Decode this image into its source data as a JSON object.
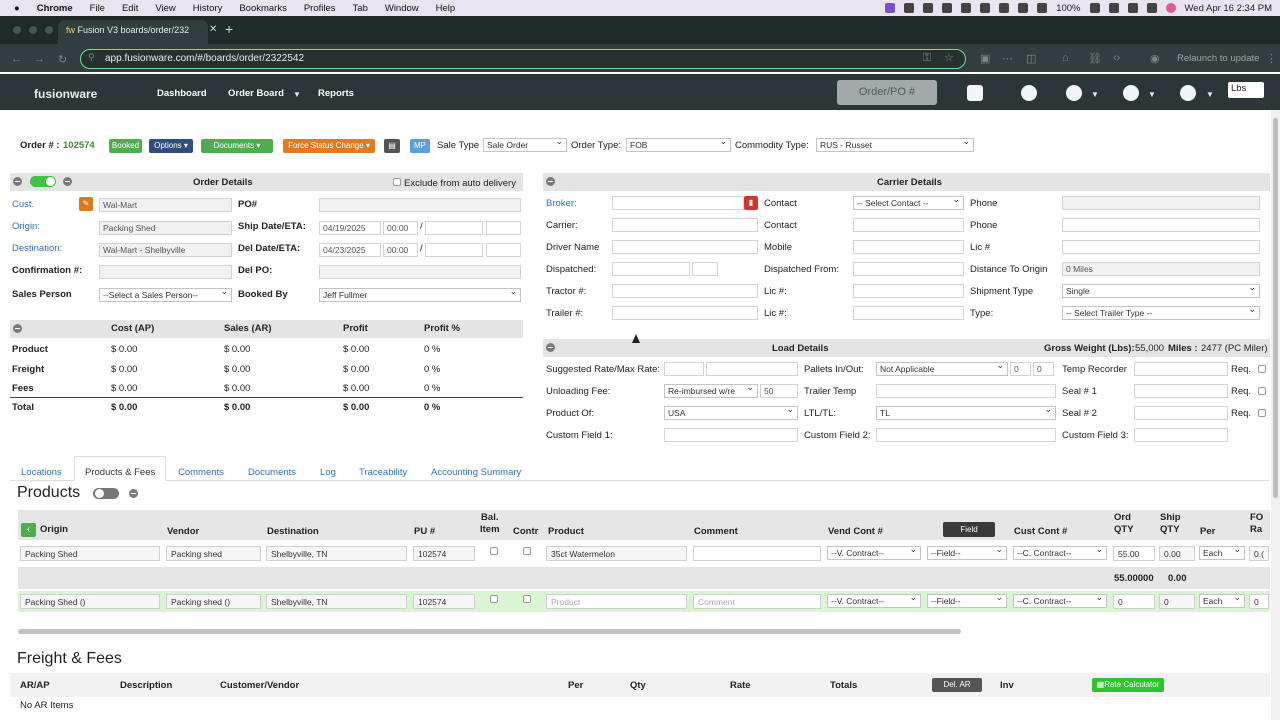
{
  "mac_menu": {
    "apple": "",
    "app": "Chrome",
    "items": [
      "File",
      "Edit",
      "View",
      "History",
      "Bookmarks",
      "Profiles",
      "Tab",
      "Window",
      "Help"
    ],
    "battery": "100%",
    "datetime": "Wed Apr 16  2:34 PM"
  },
  "browser": {
    "tab_title": "Fusion V3 boards/order/232",
    "url": "app.fusionware.com/#/boards/order/2322542",
    "relaunch": "Relaunch to update"
  },
  "app_nav": {
    "logo": "fusionware",
    "links": [
      "Dashboard",
      "Order Board",
      "Reports"
    ],
    "order_po": "Order/PO #",
    "units": "Lbs"
  },
  "order_bar": {
    "order_label": "Order # :",
    "order_number": "102574",
    "booked": "Booked",
    "options": "Options ▾",
    "documents": "Documents ▾",
    "force_status": "Force Status Change ▾",
    "mp": "MP",
    "sale_type_label": "Sale Type",
    "sale_type": "Sale Order",
    "order_type_label": "Order Type:",
    "order_type": "FOB",
    "commodity_label": "Commodity Type:",
    "commodity": "RUS - Russet"
  },
  "order_details": {
    "title": "Order Details",
    "exclude": "Exclude from auto delivery",
    "cust_label": "Cust.",
    "cust": "Wal-Mart",
    "po_label": "PO#",
    "origin_label": "Origin:",
    "origin": "Packing Shed",
    "ship_label": "Ship Date/ETA:",
    "ship_date": "04/19/2025",
    "ship_time": "00:00",
    "dest_label": "Destination:",
    "dest": "Wal-Mart - Shelbyville",
    "del_label": "Del Date/ETA:",
    "del_date": "04/23/2025",
    "del_time": "00:00",
    "confirm_label": "Confirmation #:",
    "delpo_label": "Del PO:",
    "sales_label": "Sales Person",
    "sales": "--Select a Sales Person--",
    "booked_label": "Booked By",
    "booked_by": "Jeff Fullmer",
    "slash": "/"
  },
  "financials": {
    "headers": [
      "Cost (AP)",
      "Sales (AR)",
      "Profit",
      "Profit %"
    ],
    "rows": [
      {
        "label": "Product",
        "cost": "$  0.00",
        "sales": "$  0.00",
        "profit": "$  0.00",
        "pct": "0 %"
      },
      {
        "label": "Freight",
        "cost": "$  0.00",
        "sales": "$  0.00",
        "profit": "$  0.00",
        "pct": "0 %"
      },
      {
        "label": "Fees",
        "cost": "$  0.00",
        "sales": "$  0.00",
        "profit": "$  0.00",
        "pct": "0 %"
      },
      {
        "label": "Total",
        "cost": "$  0.00",
        "sales": "$  0.00",
        "profit": "$  0.00",
        "pct": "0 %"
      }
    ]
  },
  "carrier": {
    "title": "Carrier Details",
    "broker": "Broker:",
    "contact": "Contact",
    "contact_sel": "-- Select Contact --",
    "phone": "Phone",
    "carrier": "Carrier:",
    "contact2": "Contact",
    "phone2": "Phone",
    "driver": "Driver Name",
    "mobile": "Mobile",
    "lic": "Lic #",
    "dispatched": "Dispatched:",
    "dispatched_from": "Dispatched From:",
    "distance": "Distance To Origin",
    "distance_val": "0 Miles",
    "tractor": "Tractor #:",
    "lic2": "Lic #:",
    "shipment": "Shipment Type",
    "shipment_val": "Single",
    "trailer": "Trailer #:",
    "lic3": "Lic #:",
    "type": "Type:",
    "type_val": "-- Select Trailer Type --"
  },
  "load": {
    "title": "Load Details",
    "gross": "Gross Weight (Lbs):",
    "gross_val": "55,000",
    "miles": "Miles :",
    "miles_val": "2477 (PC Miler)",
    "rate": "Suggested Rate/Max Rate:",
    "pallets": "Pallets In/Out:",
    "pallets_val": "Not Applicable",
    "p_in": "0",
    "p_out": "0",
    "temp_rec": "Temp Recorder",
    "req": "Req.",
    "unloading": "Unloading Fee:",
    "unloading_val": "Re-imbursed w/re",
    "unloading_amt": "50",
    "trailer_temp": "Trailer Temp",
    "seal1": "Seal # 1",
    "req2": "Req.",
    "product_of": "Product Of:",
    "product_of_val": "USA",
    "ltl": "LTL/TL:",
    "ltl_val": "TL",
    "seal2": "Seal # 2",
    "req3": "Req.",
    "cf1": "Custom Field 1:",
    "cf2": "Custom Field 2:",
    "cf3": "Custom Field 3:"
  },
  "tabs": [
    "Locations",
    "Products & Fees",
    "Comments",
    "Documents",
    "Log",
    "Traceability",
    "Accounting Summary"
  ],
  "products": {
    "title": "Products",
    "headers": {
      "origin": "Origin",
      "vendor": "Vendor",
      "destination": "Destination",
      "pu": "PU #",
      "bal": "Bal.\nItem",
      "contr": "Contr",
      "product": "Product",
      "comment": "Comment",
      "vend_cont": "Vend Cont #",
      "field": "Field",
      "cust_cont": "Cust Cont #",
      "ord_qty": "Ord\nQTY",
      "ship_qty": "Ship\nQTY",
      "per": "Per",
      "fo": "FO\nRa"
    },
    "row1": {
      "origin": "Packing Shed",
      "vendor": "Packing shed",
      "destination": "Shelbyville, TN",
      "pu": "102574",
      "product": "35ct Watermelon",
      "comment": "",
      "vend": "--V. Contract--",
      "field": "--Field--",
      "cust": "--C. Contract--",
      "ord": "55.00",
      "ship": "0.00",
      "per": "Each",
      "fo": "0.("
    },
    "totals": {
      "ord": "55.00000",
      "ship": "0.00"
    },
    "row2": {
      "origin": "Packing Shed ()",
      "vendor": "Packing shed ()",
      "destination": "Shelbyville, TN",
      "pu": "102574",
      "product": "Product",
      "comment": "Comment",
      "vend": "--V. Contract--",
      "field": "--Field--",
      "cust": "--C. Contract--",
      "ord": "0",
      "ship": "0",
      "per": "Each",
      "fo": "0"
    }
  },
  "freight": {
    "title": "Freight & Fees",
    "headers": [
      "AR/AP",
      "Description",
      "Customer/Vendor",
      "Per",
      "Qty",
      "Rate",
      "Totals",
      "Del. AR",
      "Inv"
    ],
    "rate_calc": "Rate Calculator",
    "empty": "No AR Items"
  },
  "colors": {
    "booked": "#4cae4c",
    "options": "#2f4d7f",
    "documents": "#4cae4c",
    "force": "#e07b20",
    "mp": "#5aa0e0"
  }
}
